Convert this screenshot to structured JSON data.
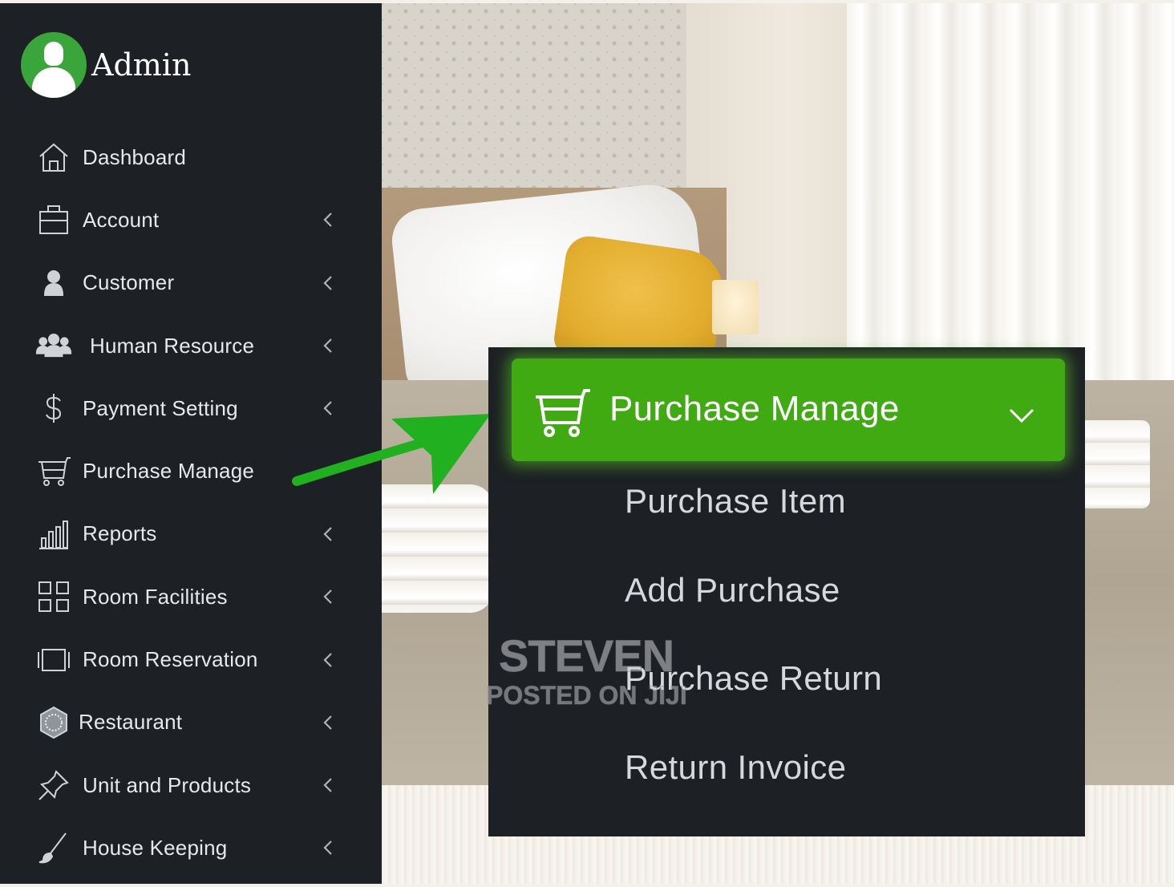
{
  "profile": {
    "name": "Admin"
  },
  "sidebar": {
    "items": [
      {
        "label": "Dashboard",
        "icon": "home-icon",
        "has_submenu": false
      },
      {
        "label": "Account",
        "icon": "briefcase-icon",
        "has_submenu": true
      },
      {
        "label": "Customer",
        "icon": "user-icon",
        "has_submenu": true
      },
      {
        "label": "Human Resource",
        "icon": "users-icon",
        "has_submenu": true
      },
      {
        "label": "Payment Setting",
        "icon": "dollar-icon",
        "has_submenu": true
      },
      {
        "label": "Purchase Manage",
        "icon": "cart-icon",
        "has_submenu": false
      },
      {
        "label": "Reports",
        "icon": "bar-chart-icon",
        "has_submenu": true
      },
      {
        "label": "Room Facilities",
        "icon": "grid-icon",
        "has_submenu": true
      },
      {
        "label": "Room Reservation",
        "icon": "tablet-icon",
        "has_submenu": true
      },
      {
        "label": "Restaurant",
        "icon": "restaurant-icon",
        "has_submenu": true
      },
      {
        "label": "Unit and Products",
        "icon": "pin-icon",
        "has_submenu": true
      },
      {
        "label": "House Keeping",
        "icon": "brush-icon",
        "has_submenu": true
      }
    ]
  },
  "zoom": {
    "title": "Purchase Manage",
    "icon": "cart-icon",
    "items": [
      "Purchase Item",
      "Add Purchase",
      "Purchase Return",
      "Return Invoice"
    ]
  },
  "watermark": {
    "line1": "STEVEN",
    "line2": "POSTED ON JIJI"
  },
  "colors": {
    "sidebar_bg": "#1d2024",
    "accent_green": "#3faa12",
    "avatar_green": "#3aa53a",
    "arrow_green": "#20b020"
  }
}
